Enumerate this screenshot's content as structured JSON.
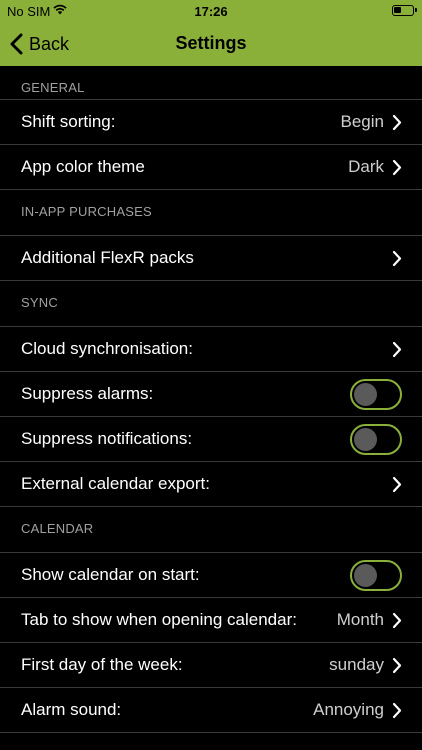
{
  "status_bar": {
    "carrier": "No SIM",
    "time": "17:26"
  },
  "nav": {
    "back_label": "Back",
    "title": "Settings"
  },
  "sections": {
    "general": {
      "header": "GENERAL",
      "rows": [
        {
          "label": "Shift sorting:",
          "value": "Begin"
        },
        {
          "label": "App color theme",
          "value": "Dark"
        }
      ]
    },
    "purchases": {
      "header": "IN-APP PURCHASES",
      "rows": [
        {
          "label": "Additional FlexR packs"
        }
      ]
    },
    "sync": {
      "header": "SYNC",
      "rows": [
        {
          "label": "Cloud synchronisation:"
        },
        {
          "label": "Suppress alarms:",
          "toggle_on": false
        },
        {
          "label": "Suppress notifications:",
          "toggle_on": false
        },
        {
          "label": "External calendar export:"
        }
      ]
    },
    "calendar": {
      "header": "CALENDAR",
      "rows": [
        {
          "label": "Show calendar on start:",
          "toggle_on": false
        },
        {
          "label": "Tab to show when opening calendar:",
          "value": "Month"
        },
        {
          "label": "First day of the week:",
          "value": "sunday"
        },
        {
          "label": "Alarm sound:",
          "value": "Annoying"
        }
      ]
    }
  },
  "colors": {
    "accent": "#8bb03a",
    "background": "#000000",
    "separator": "#3a3a3a"
  }
}
